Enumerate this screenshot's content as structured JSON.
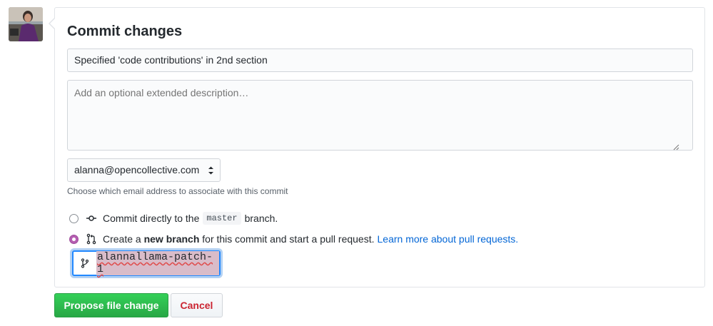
{
  "commit_form": {
    "title": "Commit changes",
    "summary_value": "Specified 'code contributions' in 2nd section",
    "description_placeholder": "Add an optional extended description…",
    "email_selected": "alanna@opencollective.com",
    "email_note": "Choose which email address to associate with this commit",
    "option_direct": {
      "prefix": "Commit directly to the",
      "branch": "master",
      "suffix": "branch."
    },
    "option_new_branch": {
      "prefix": "Create a",
      "bold": "new branch",
      "suffix": "for this commit and start a pull request.",
      "link": "Learn more about pull requests."
    },
    "new_branch_name": "alannallama-patch-1",
    "selected_option": "new-branch"
  },
  "actions": {
    "propose_label": "Propose file change",
    "cancel_label": "Cancel"
  },
  "colors": {
    "primary_green": "#28a745",
    "cancel_red": "#cb2431",
    "link_blue": "#0366d6",
    "radio_selected": "#b55eb1"
  },
  "icons": {
    "commit": "git-commit-icon",
    "pull_request": "git-pull-request-icon",
    "branch": "git-branch-icon"
  }
}
